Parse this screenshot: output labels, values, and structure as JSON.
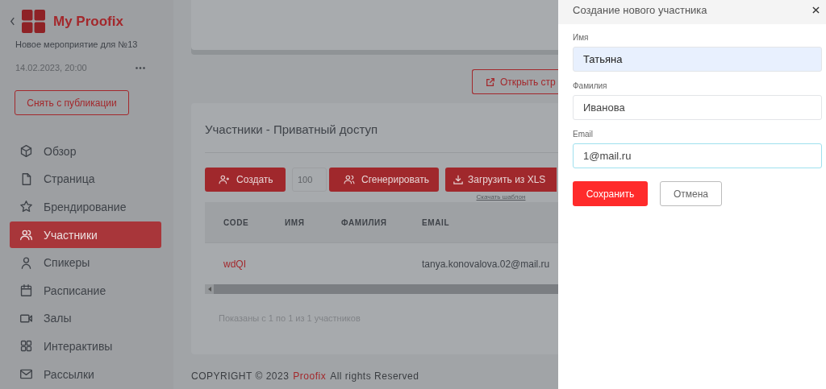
{
  "sidebar": {
    "brand": "My Proofix",
    "event_name": "Новое мероприятие для №13",
    "event_date": "14.02.2023, 20:00",
    "unpublish_button": "Снять с публикации",
    "nav": [
      {
        "label": "Обзор",
        "selected": false
      },
      {
        "label": "Страница",
        "selected": false
      },
      {
        "label": "Брендирование",
        "selected": false
      },
      {
        "label": "Участники",
        "selected": true
      },
      {
        "label": "Спикеры",
        "selected": false
      },
      {
        "label": "Расписание",
        "selected": false
      },
      {
        "label": "Залы",
        "selected": false
      },
      {
        "label": "Интерактивы",
        "selected": false
      },
      {
        "label": "Рассылки",
        "selected": false
      }
    ]
  },
  "open_page_button": "Открыть стр",
  "participants": {
    "title": "Участники - Приватный доступ",
    "create_button": "Создать",
    "count_field": {
      "placeholder": "100"
    },
    "generate_button": "Сгенерировать",
    "upload_button": "Загрузить из XLS",
    "template_link": "Скачать шаблон",
    "table": {
      "columns": [
        "CODE",
        "ИМЯ",
        "ФАМИЛИЯ",
        "EMAIL"
      ],
      "rows": [
        [
          "wdQI",
          "",
          "",
          "tanya.konovalova.02@mail.ru"
        ]
      ]
    },
    "summary": "Показаны с 1 по 1 из 1 участников"
  },
  "footer": {
    "prefix": "COPYRIGHT © 2023",
    "brand": "Proofix",
    "suffix": "All rights Reserved"
  },
  "drawer": {
    "title": "Создание нового участника",
    "fields": [
      {
        "label": "Имя",
        "value": "Татьяна",
        "autofilled": true,
        "focused": false
      },
      {
        "label": "Фамилия",
        "value": "Иванова",
        "autofilled": false,
        "focused": false
      },
      {
        "label": "Email",
        "value": "1@mail.ru",
        "autofilled": false,
        "focused": true
      }
    ],
    "save_button": "Сохранить",
    "cancel_button": "Отмена"
  }
}
